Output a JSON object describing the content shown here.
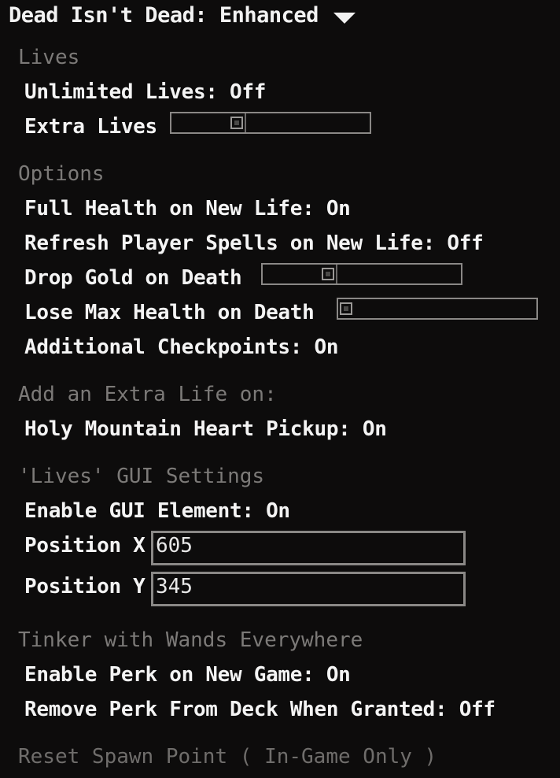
{
  "header": {
    "title": "Dead Isn't Dead: Enhanced",
    "dropdown_icon": "triangle-down-icon"
  },
  "lives": {
    "category": "Lives",
    "unlimited_lives": "Unlimited Lives: Off",
    "extra_lives_label": "Extra Lives",
    "extra_lives_value": 0.32
  },
  "options": {
    "category": "Options",
    "full_health": "Full Health on New Life: On",
    "refresh_spells": "Refresh Player Spells on New Life: Off",
    "drop_gold_label": "Drop Gold on Death",
    "drop_gold_value": 0.32,
    "lose_max_health_label": "Lose Max Health on Death",
    "lose_max_health_value": 0.0,
    "additional_checkpoints": "Additional Checkpoints: On"
  },
  "extra_life": {
    "category": "Add an Extra Life on:",
    "holy_mountain": "Holy Mountain Heart Pickup: On"
  },
  "gui": {
    "category": "'Lives' GUI Settings",
    "enable_gui": "Enable GUI Element: On",
    "position_x_label": "Position X",
    "position_x_value": "605",
    "position_y_label": "Position Y",
    "position_y_value": "345"
  },
  "tinker": {
    "category": "Tinker with Wands Everywhere",
    "enable_perk": "Enable Perk on New Game: On",
    "remove_perk": "Remove Perk From Deck When Granted: Off"
  },
  "reset": {
    "label": "Reset Spawn Point ( In-Game Only )"
  }
}
